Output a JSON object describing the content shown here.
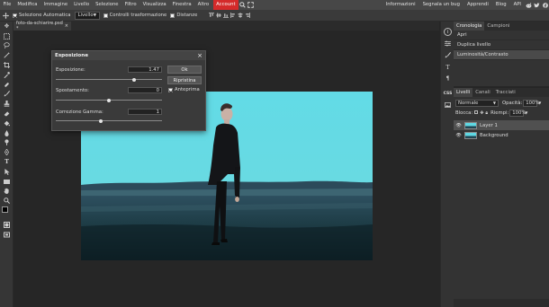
{
  "menu": {
    "items": [
      "File",
      "Modifica",
      "Immagine",
      "Livello",
      "Selezione",
      "Filtro",
      "Visualizza",
      "Finestra",
      "Altro"
    ],
    "account": "Account",
    "right_links": [
      "Informazioni",
      "Segnala un bug",
      "Apprendi",
      "Blog",
      "API"
    ],
    "icons": [
      "search-icon",
      "fullscreen-icon"
    ],
    "social_icons": [
      "reddit-icon",
      "twitter-icon",
      "facebook-icon"
    ]
  },
  "options": {
    "auto_select_label": "Selezione Automatica",
    "auto_select_checked": true,
    "target_value": "Livello",
    "transform_controls_label": "Controlli trasformazione",
    "distances_label": "Distanze"
  },
  "document": {
    "tab_title": "foto-da-schiarire.psd *",
    "close_glyph": "×"
  },
  "dialog": {
    "title": "Esposizione",
    "close_glyph": "×",
    "exposure_label": "Esposizione:",
    "exposure_value": "1.47",
    "exposure_slider": 0.74,
    "offset_label": "Spostamento:",
    "offset_value": "0",
    "offset_slider": 0.5,
    "gamma_label": "Correzione Gamma:",
    "gamma_value": "1",
    "gamma_slider": 0.42,
    "ok_label": "Ok",
    "reset_label": "Ripristina",
    "preview_label": "Anteprima",
    "preview_checked": true
  },
  "history": {
    "tabs": [
      "Cronologia",
      "Campioni"
    ],
    "items": [
      "Apri",
      "Duplica livello",
      "Luminosità/Contrasto"
    ],
    "selected_index": 2
  },
  "layers": {
    "tabs": [
      "Livelli",
      "Canali",
      "Tracciati"
    ],
    "blend_mode": "Normale",
    "opacity_label": "Opacità:",
    "opacity_value": "100%",
    "lock_label": "Blocca:",
    "fill_label": "Riempi:",
    "fill_value": "100%",
    "items": [
      {
        "name": "Layer 1",
        "selected": true
      },
      {
        "name": "Background",
        "selected": false
      }
    ]
  },
  "right_icons": [
    "info-icon",
    "sliders-icon",
    "brush-settings-icon",
    "character-icon",
    "paragraph-icon",
    "css-icon",
    "image-icon"
  ],
  "colors": {
    "accent": "#d42a2a",
    "sky": "#63d9e4",
    "panel": "#333333"
  }
}
